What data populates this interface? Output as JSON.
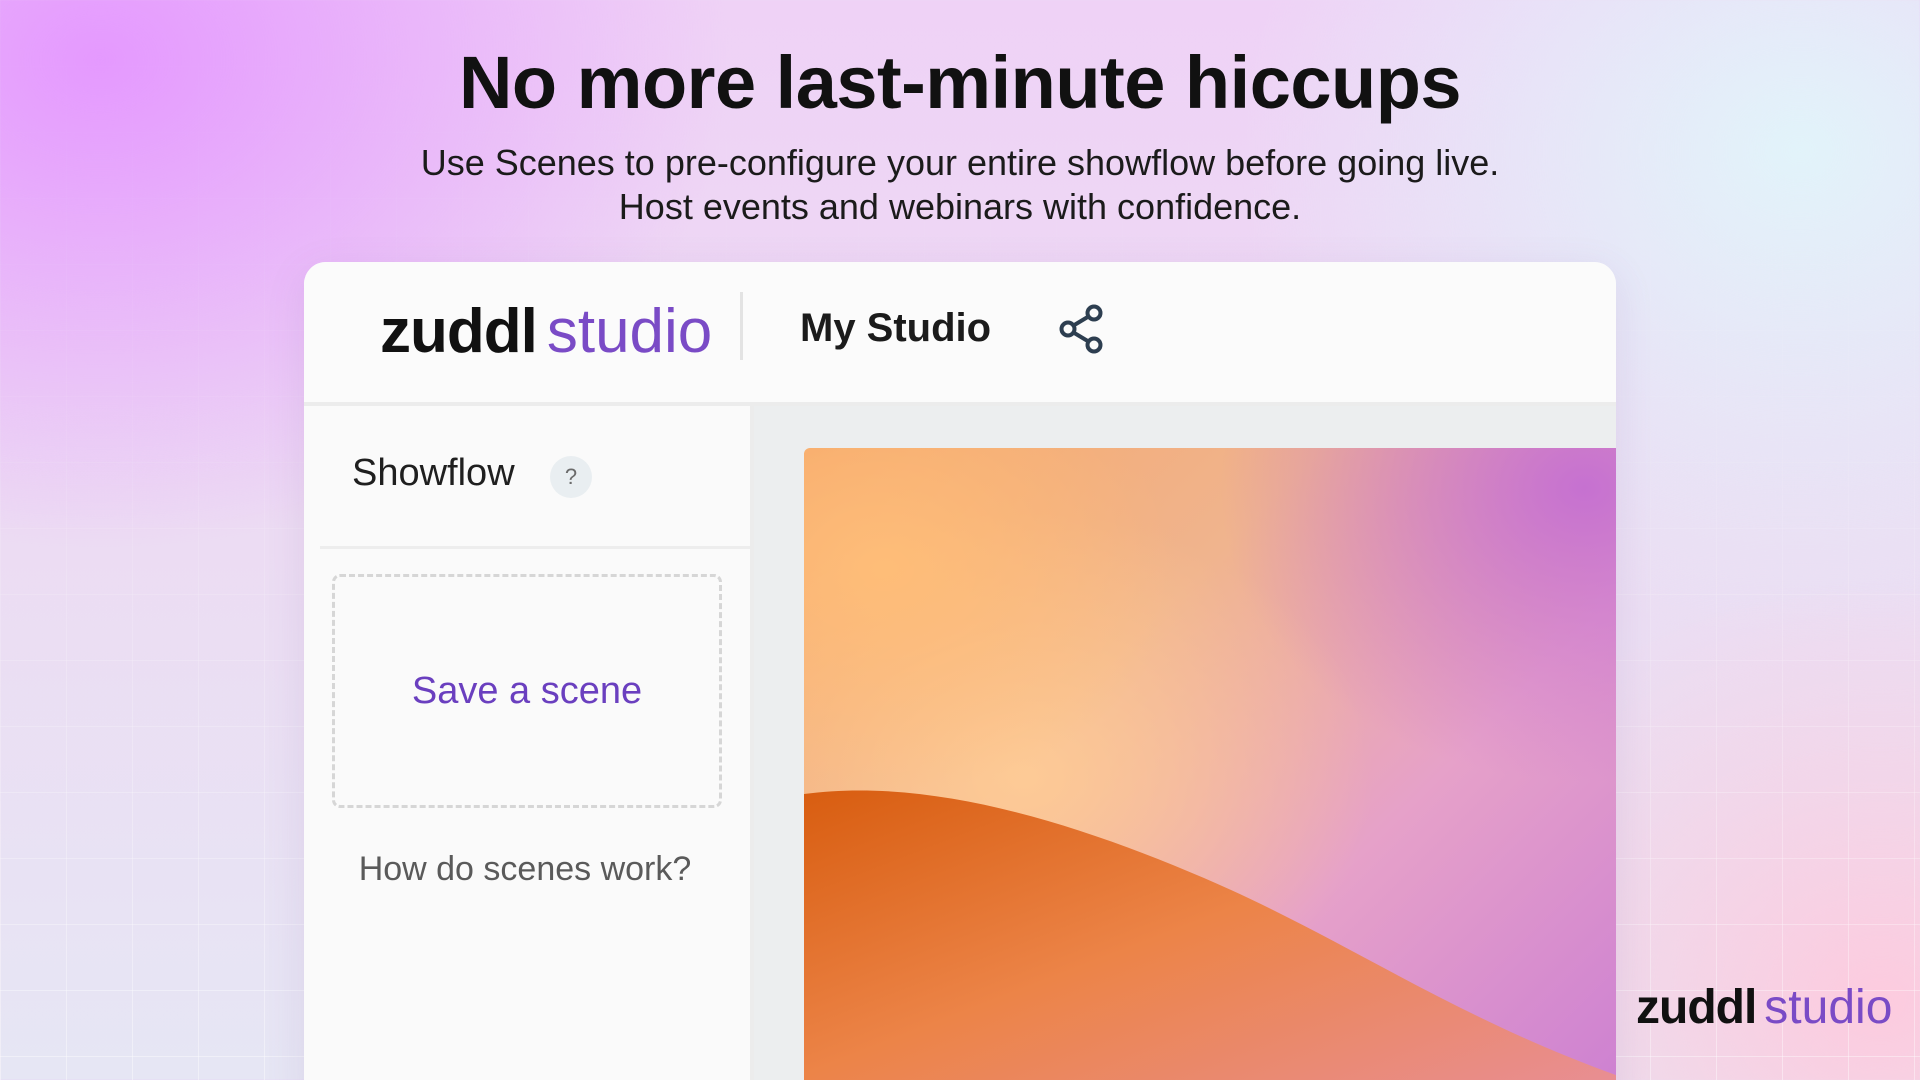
{
  "hero": {
    "title": "No more last-minute hiccups",
    "subtitle_line1": "Use Scenes to pre-configure your entire showflow before going live.",
    "subtitle_line2": "Host events and webinars with confidence."
  },
  "header": {
    "logo_brand": "zuddl",
    "logo_product": "studio",
    "studio_name": "My Studio",
    "share_icon": "share-icon"
  },
  "sidebar": {
    "title": "Showflow",
    "help_label": "?",
    "save_scene_label": "Save a scene",
    "help_link": "How do scenes work?"
  },
  "footer": {
    "logo_brand": "zuddl",
    "logo_product": "studio"
  },
  "colors": {
    "brand_purple": "#7a4bc6",
    "action_purple": "#6a3fbf",
    "text_dark": "#111111"
  }
}
